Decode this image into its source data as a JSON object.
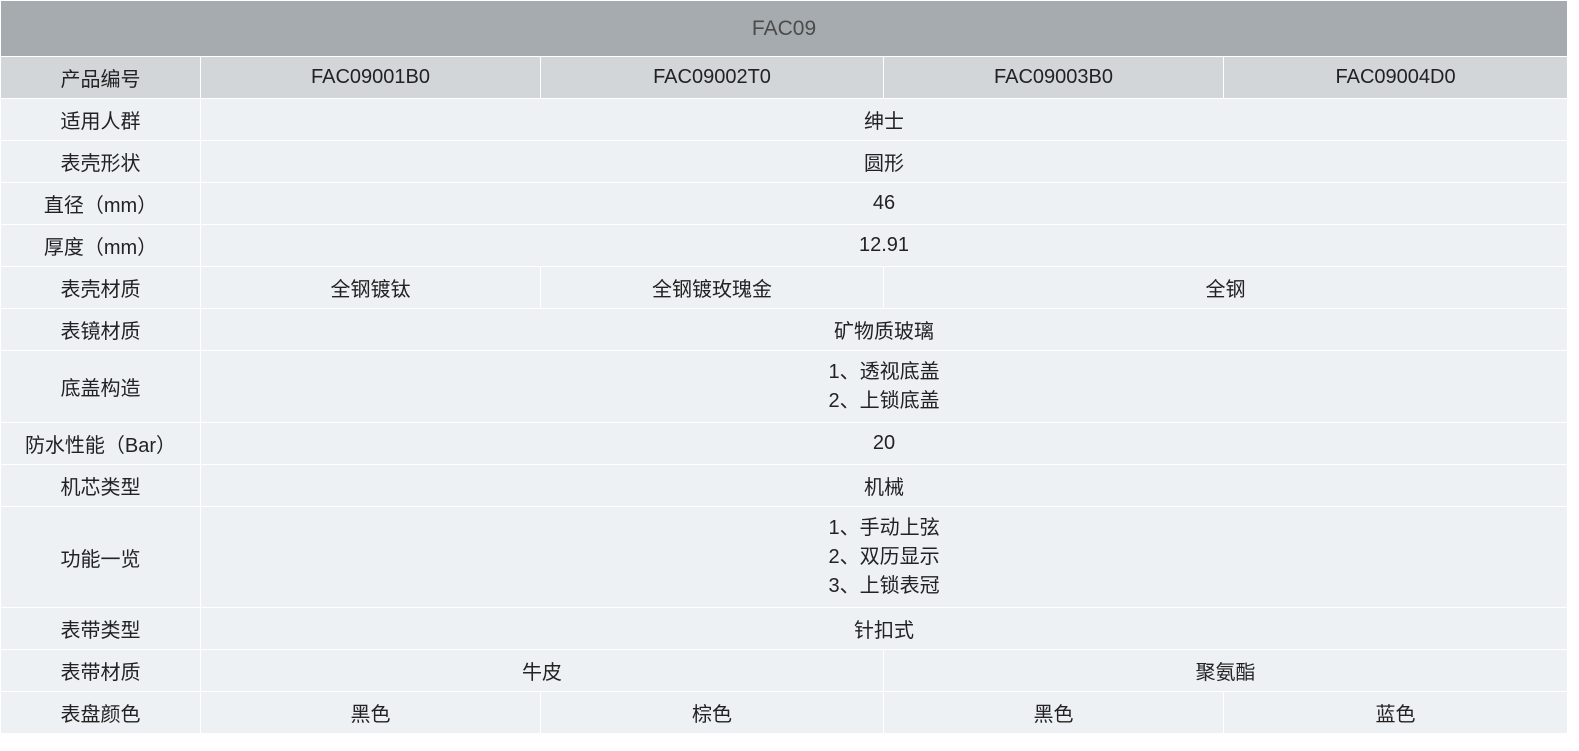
{
  "title": "FAC09",
  "header": {
    "label": "产品编号",
    "models": [
      "FAC09001B0",
      "FAC09002T0",
      "FAC09003B0",
      "FAC09004D0"
    ]
  },
  "rows": {
    "audience": {
      "label": "适用人群",
      "value": "绅士"
    },
    "case_shape": {
      "label": "表壳形状",
      "value": "圆形"
    },
    "diameter": {
      "label": "直径（mm）",
      "value": "46"
    },
    "thickness": {
      "label": "厚度（mm）",
      "value": "12.91"
    },
    "case_material": {
      "label": "表壳材质",
      "values": [
        "全钢镀钛",
        "全钢镀玫瑰金",
        "全钢"
      ]
    },
    "crystal_material": {
      "label": "表镜材质",
      "value": "矿物质玻璃"
    },
    "caseback": {
      "label": "底盖构造",
      "lines": [
        "1、透视底盖",
        "2、上锁底盖"
      ]
    },
    "water_resistance": {
      "label": "防水性能（Bar）",
      "value": "20"
    },
    "movement": {
      "label": "机芯类型",
      "value": "机械"
    },
    "functions": {
      "label": "功能一览",
      "lines": [
        "1、手动上弦",
        "2、双历显示",
        "3、上锁表冠"
      ]
    },
    "strap_type": {
      "label": "表带类型",
      "value": "针扣式"
    },
    "strap_material": {
      "label": "表带材质",
      "values": [
        "牛皮",
        "聚氨酯"
      ]
    },
    "dial_color": {
      "label": "表盘颜色",
      "values": [
        "黑色",
        "棕色",
        "黑色",
        "蓝色"
      ]
    }
  }
}
